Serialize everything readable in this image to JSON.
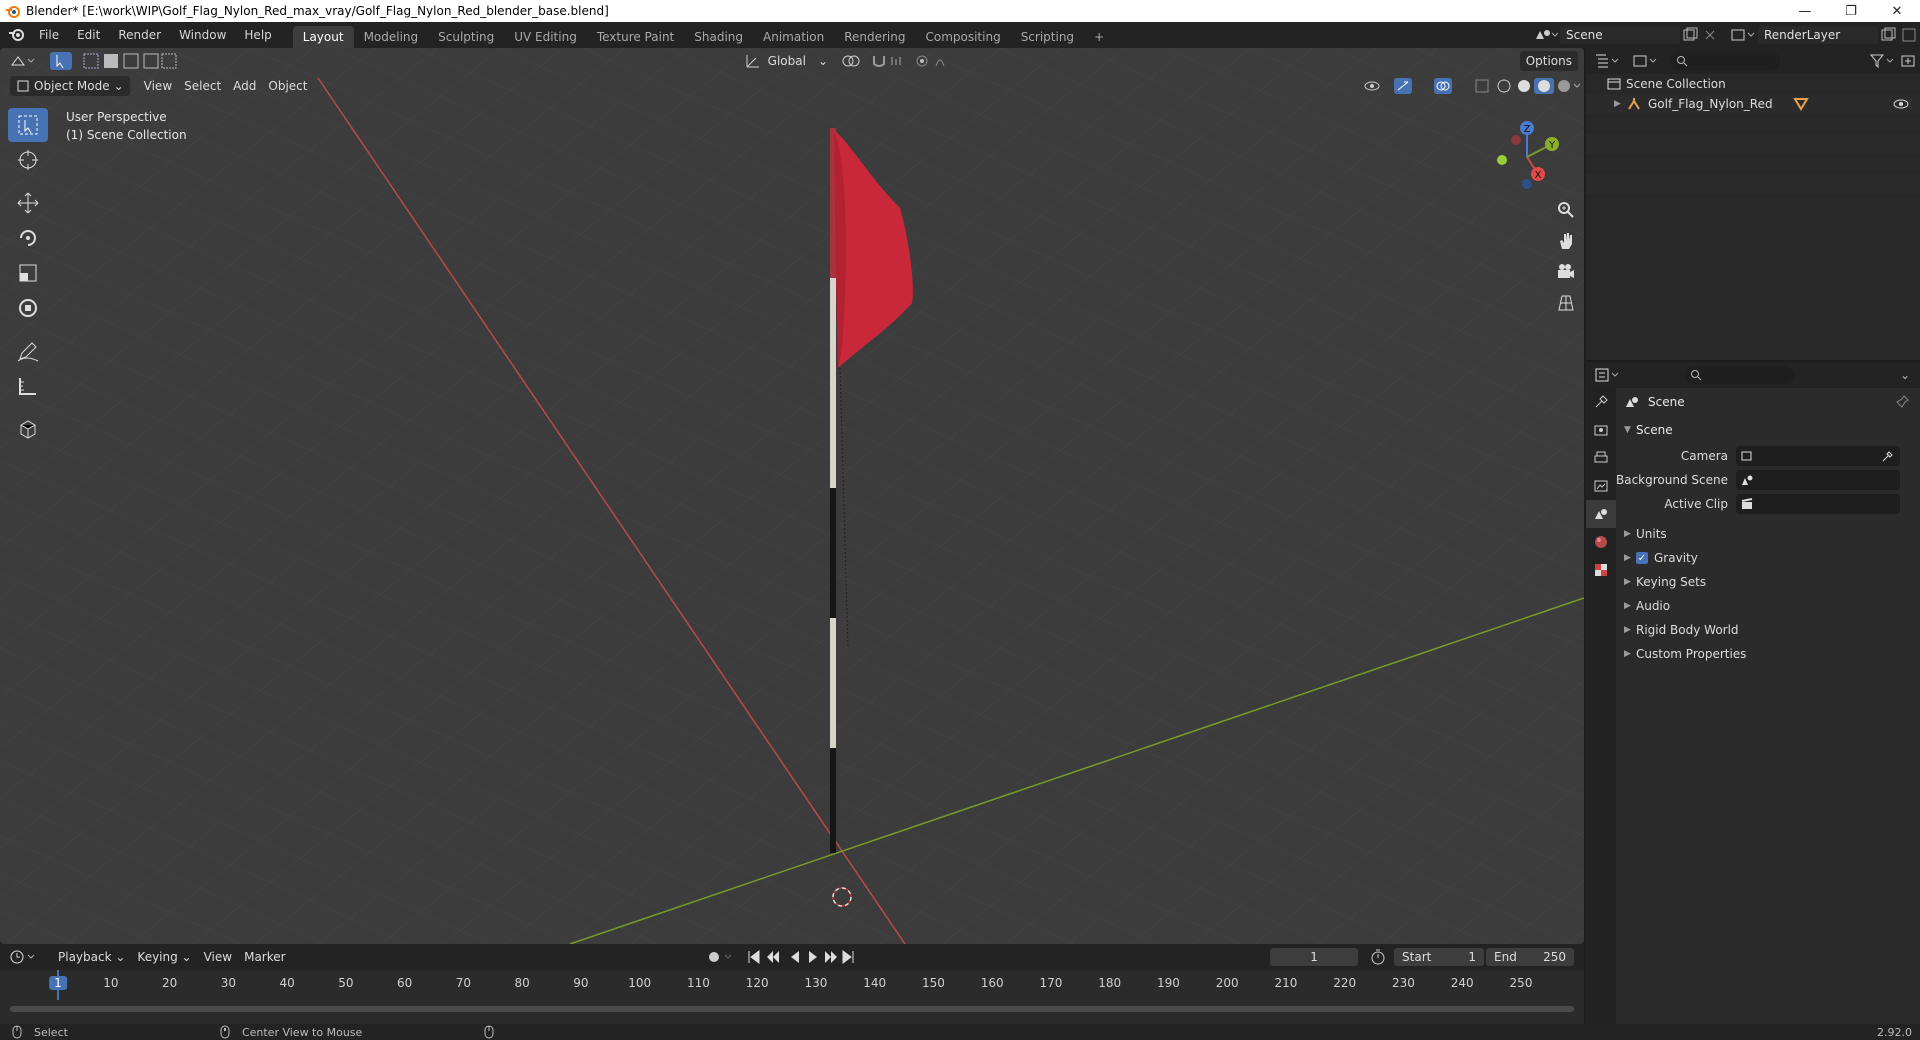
{
  "window": {
    "title": "Blender* [E:\\work\\WIP\\Golf_Flag_Nylon_Red_max_vray/Golf_Flag_Nylon_Red_blender_base.blend]"
  },
  "menu": [
    "File",
    "Edit",
    "Render",
    "Window",
    "Help"
  ],
  "workspaces": [
    {
      "label": "Layout",
      "active": true
    },
    {
      "label": "Modeling"
    },
    {
      "label": "Sculpting"
    },
    {
      "label": "UV Editing"
    },
    {
      "label": "Texture Paint"
    },
    {
      "label": "Shading"
    },
    {
      "label": "Animation"
    },
    {
      "label": "Rendering"
    },
    {
      "label": "Compositing"
    },
    {
      "label": "Scripting"
    }
  ],
  "scene_field": "Scene",
  "renderlayer_field": "RenderLayer",
  "viewport": {
    "mode": "Object Mode",
    "menus": [
      "View",
      "Select",
      "Add",
      "Object"
    ],
    "transform_orientation": "Global",
    "options_label": "Options",
    "perspective_label": "User Perspective",
    "collection_label": "(1) Scene Collection",
    "axis_labels": {
      "x": "X",
      "y": "Y",
      "z": "Z"
    },
    "colors": {
      "flag": "#c8283a",
      "x_axis": "#c84a4a",
      "y_axis": "#7a9a2a",
      "background": "#3c3c3c"
    }
  },
  "timeline": {
    "menus": [
      "Playback",
      "Keying",
      "View",
      "Marker"
    ],
    "current_frame": "1",
    "start_label": "Start",
    "start_value": "1",
    "end_label": "End",
    "end_value": "250",
    "ticks": [
      "1",
      "10",
      "20",
      "30",
      "40",
      "50",
      "60",
      "70",
      "80",
      "90",
      "100",
      "110",
      "120",
      "130",
      "140",
      "150",
      "160",
      "170",
      "180",
      "190",
      "200",
      "210",
      "220",
      "230",
      "240",
      "250"
    ]
  },
  "outliner": {
    "root": "Scene Collection",
    "items": [
      {
        "label": "Golf_Flag_Nylon_Red"
      }
    ]
  },
  "properties": {
    "header": "Scene",
    "panel": "Scene",
    "camera_label": "Camera",
    "background_scene_label": "Background Scene",
    "active_clip_label": "Active Clip",
    "subpanels": [
      "Units",
      "Gravity",
      "Keying Sets",
      "Audio",
      "Rigid Body World",
      "Custom Properties"
    ]
  },
  "status": {
    "select": "Select",
    "center_view": "Center View to Mouse",
    "version": "2.92.0"
  }
}
